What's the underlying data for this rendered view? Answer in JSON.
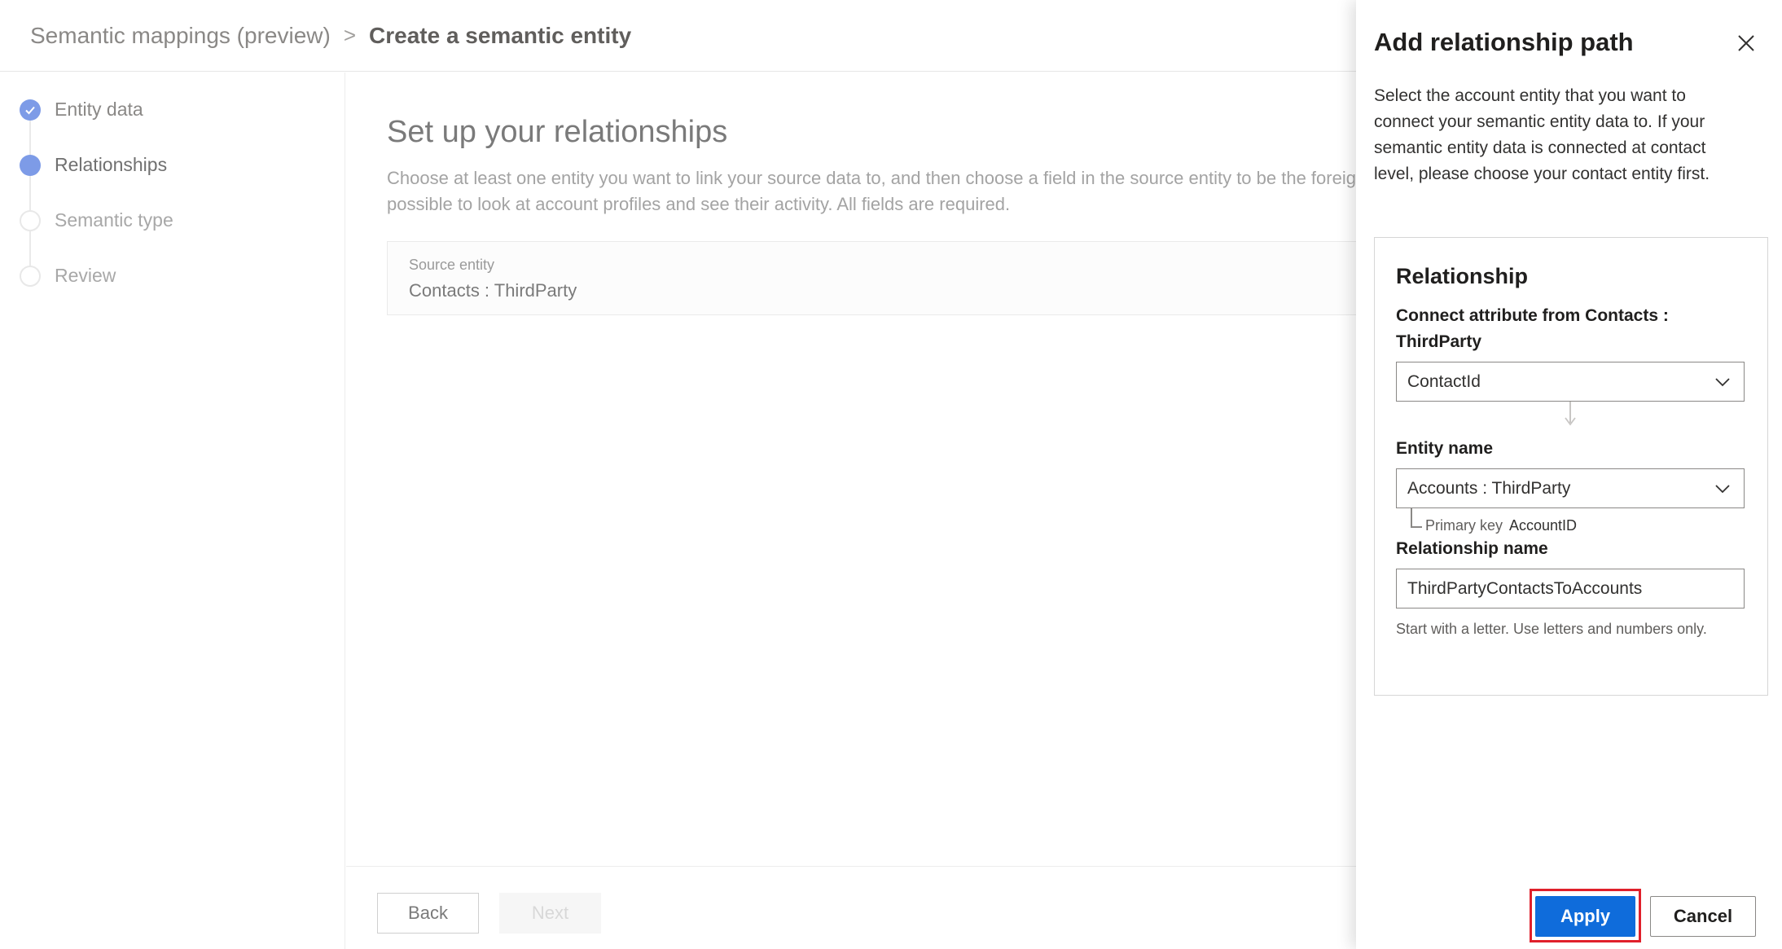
{
  "breadcrumb": {
    "root": "Semantic mappings (preview)",
    "separator": ">",
    "current": "Create a semantic entity"
  },
  "steps": [
    {
      "label": "Entity data",
      "state": "done"
    },
    {
      "label": "Relationships",
      "state": "active"
    },
    {
      "label": "Semantic type",
      "state": "todo"
    },
    {
      "label": "Review",
      "state": "todo"
    }
  ],
  "main": {
    "title": "Set up your relationships",
    "description_line1": "Choose at least one entity you want to link your source data to, and then choose a field in the source entity to be the foreig",
    "description_line2": "possible to look at account profiles and see their activity. All fields are required.",
    "source_entity_label": "Source entity",
    "source_entity_value": "Contacts : ThirdParty"
  },
  "footer": {
    "back_label": "Back",
    "next_label": "Next"
  },
  "panel": {
    "title": "Add relationship path",
    "description": "Select the account entity that you want to connect your semantic entity data to. If your semantic entity data is connected at contact level, please choose your contact entity first.",
    "relationship": {
      "heading": "Relationship",
      "connect_label": "Connect attribute from Contacts : ThirdParty",
      "connect_value": "ContactId",
      "entity_label": "Entity name",
      "entity_value": "Accounts : ThirdParty",
      "primary_key_label": "Primary key",
      "primary_key_value": "AccountID",
      "name_label": "Relationship name",
      "name_value": "ThirdPartyContactsToAccounts",
      "name_helper": "Start with a letter. Use letters and numbers only."
    },
    "apply_label": "Apply",
    "cancel_label": "Cancel"
  },
  "colors": {
    "accent": "#0f6cdb",
    "step_dot": "#7d9be7",
    "highlight": "#e0202b"
  }
}
